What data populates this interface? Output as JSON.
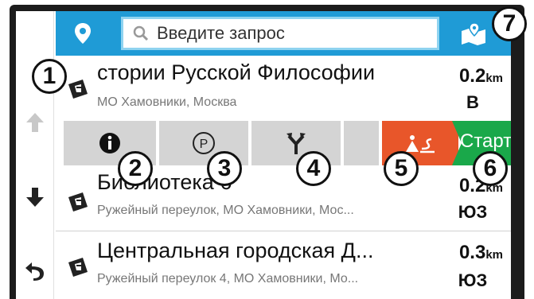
{
  "search": {
    "placeholder": "Введите запрос"
  },
  "results": [
    {
      "title": "стории Русской Философии",
      "address": "МО Хамовники, Москва",
      "distance": "0.2",
      "unit": "km",
      "direction": "В"
    },
    {
      "title": "Библиотека 6",
      "address": "Ружейный переулок, МО Хамовники, Мос...",
      "distance": "0.2",
      "unit": "km",
      "direction": "ЮЗ"
    },
    {
      "title": "Центральная городская Д...",
      "address": "Ружейный переулок 4, МО Хамовники, Мо...",
      "distance": "0.3",
      "unit": "km",
      "direction": "ЮЗ"
    }
  ],
  "actions": {
    "start_label": "Старт"
  },
  "callouts": [
    "1",
    "2",
    "3",
    "4",
    "5",
    "6",
    "7"
  ],
  "colors": {
    "topbar": "#1f9bd6",
    "route": "#e8562a",
    "start": "#1aa84a",
    "action_bg": "#d4d4d4"
  },
  "icons": {
    "location": "location-pin-icon",
    "search": "magnifier-icon",
    "map": "map-icon",
    "up": "arrow-up-icon",
    "down": "arrow-down-icon",
    "back": "back-icon",
    "info": "info-icon",
    "parking": "parking-icon",
    "route_options": "route-fork-icon",
    "route_plan": "route-plan-icon",
    "poi": "poi-flag-icon"
  }
}
